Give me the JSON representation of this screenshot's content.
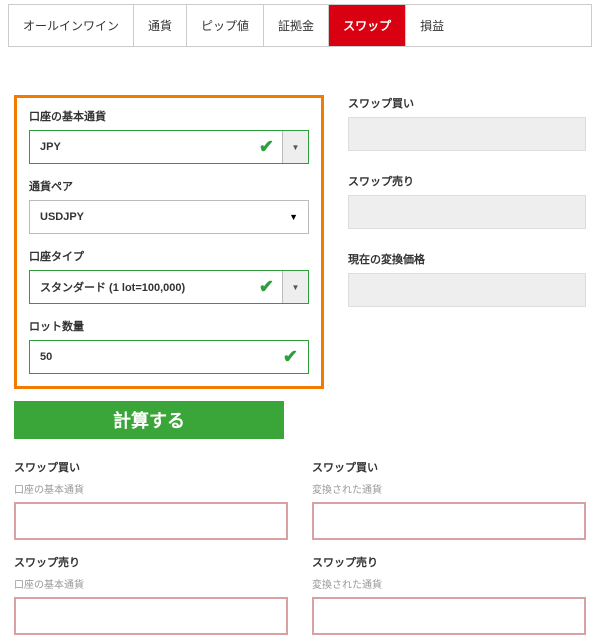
{
  "tabs": {
    "t0": "オールインワイン",
    "t1": "通貨",
    "t2": "ピップ値",
    "t3": "証拠金",
    "t4": "スワップ",
    "t5": "損益"
  },
  "form": {
    "base_currency_label": "口座の基本通貨",
    "base_currency_value": "JPY",
    "pair_label": "通貨ペア",
    "pair_value": "USDJPY",
    "account_type_label": "口座タイプ",
    "account_type_value": "スタンダード (1 lot=100,000)",
    "lot_label": "ロット数量",
    "lot_value": "50"
  },
  "right": {
    "swap_buy_label": "スワップ買い",
    "swap_sell_label": "スワップ売り",
    "rate_label": "現在の変換価格"
  },
  "button": {
    "calc": "計算する"
  },
  "results": {
    "swap_buy": "スワップ買い",
    "swap_sell": "スワップ売り",
    "sub_base": "口座の基本通貨",
    "sub_conv": "変換された通貨"
  }
}
